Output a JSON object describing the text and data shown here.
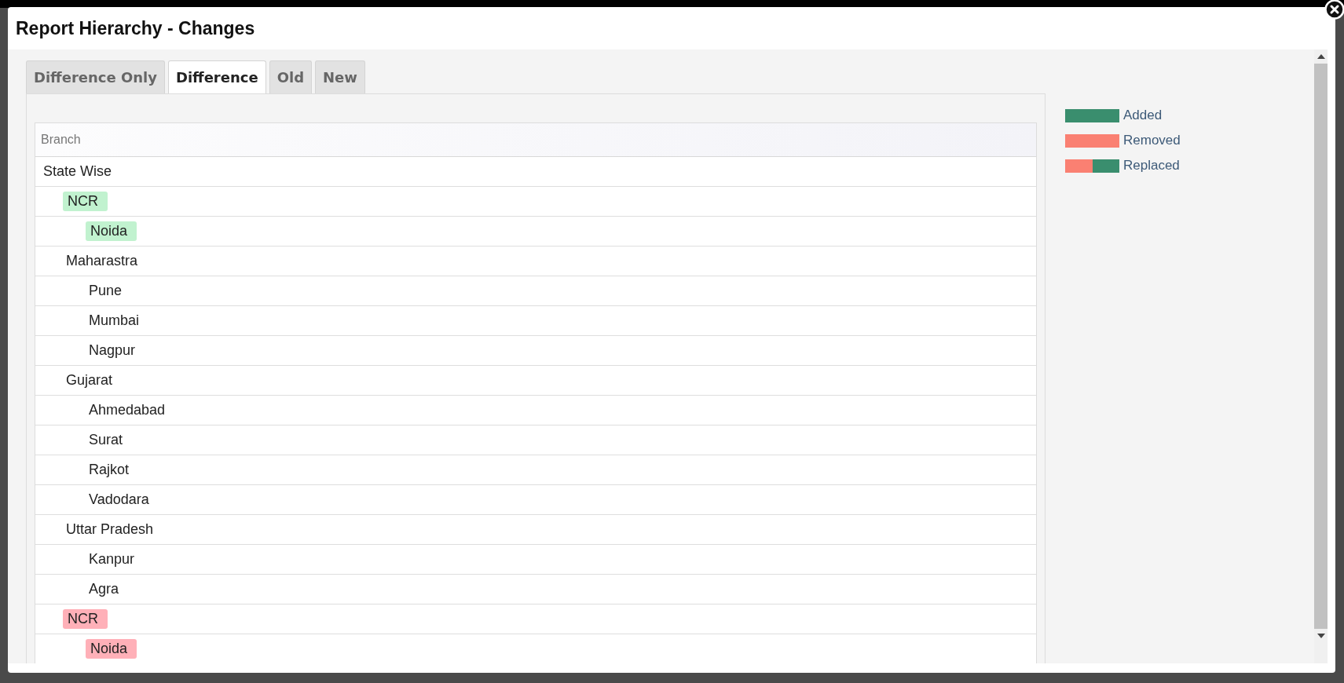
{
  "dialog": {
    "title": "Report Hierarchy - Changes"
  },
  "tabs": [
    {
      "label": "Difference Only",
      "selected": false
    },
    {
      "label": "Difference",
      "selected": true
    },
    {
      "label": "Old",
      "selected": false
    },
    {
      "label": "New",
      "selected": false
    }
  ],
  "table": {
    "columns": [
      "Branch"
    ],
    "tree": [
      {
        "label": "State Wise",
        "kind": "plain",
        "children": [
          {
            "label": "NCR",
            "kind": "added",
            "children": [
              {
                "label": "Noida",
                "kind": "added"
              }
            ]
          },
          {
            "label": "Maharastra",
            "kind": "plain",
            "children": [
              {
                "label": "Pune",
                "kind": "plain"
              },
              {
                "label": "Mumbai",
                "kind": "plain"
              },
              {
                "label": "Nagpur",
                "kind": "plain"
              }
            ]
          },
          {
            "label": "Gujarat",
            "kind": "plain",
            "children": [
              {
                "label": "Ahmedabad",
                "kind": "plain"
              },
              {
                "label": "Surat",
                "kind": "plain"
              },
              {
                "label": "Rajkot",
                "kind": "plain"
              },
              {
                "label": "Vadodara",
                "kind": "plain"
              }
            ]
          },
          {
            "label": "Uttar Pradesh",
            "kind": "plain",
            "children": [
              {
                "label": "Kanpur",
                "kind": "plain"
              },
              {
                "label": "Agra",
                "kind": "plain"
              }
            ]
          },
          {
            "label": "NCR",
            "kind": "removed",
            "children": [
              {
                "label": "Noida",
                "kind": "removed"
              }
            ]
          }
        ]
      }
    ]
  },
  "legend": [
    {
      "kind": "added",
      "label": "Added"
    },
    {
      "kind": "removed",
      "label": "Removed"
    },
    {
      "kind": "replaced",
      "label": "Replaced"
    }
  ]
}
